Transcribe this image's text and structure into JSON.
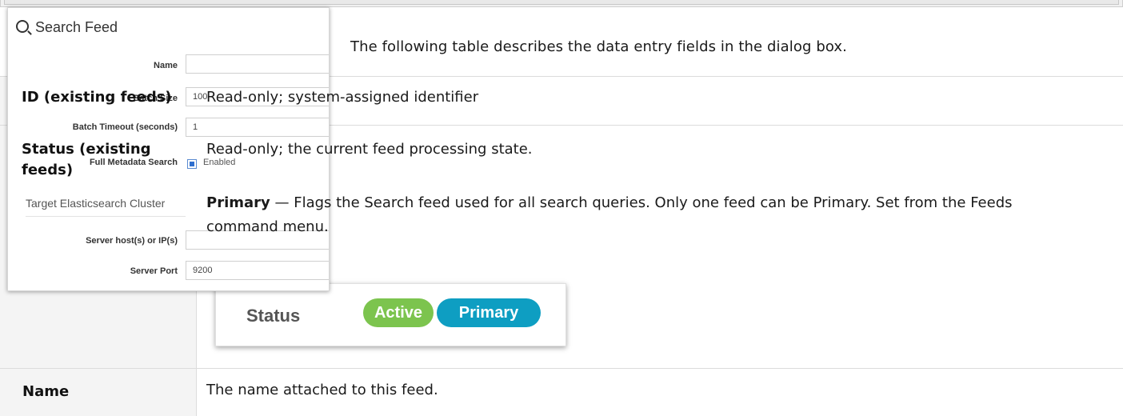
{
  "intro_text": "The following table describes the data entry fields in the dialog box.",
  "table": {
    "rows": [
      {
        "key": "ID (existing feeds)",
        "value": "Read-only; system-assigned identifier"
      },
      {
        "key_line1": "Status (existing",
        "key_line2": "feeds)",
        "value": "Read-only; the current feed processing state.",
        "primary_term": "Primary",
        "primary_desc_line1": " — Flags the Search feed used for all search queries. Only one feed can be Primary. Set from the Feeds",
        "primary_desc_line2": "command menu."
      },
      {
        "key": "Name",
        "value": "The name attached to this feed."
      }
    ]
  },
  "status_image": {
    "label": "Status",
    "badges": [
      {
        "text": "Active",
        "color": "#7cc44e"
      },
      {
        "text": "Primary",
        "color": "#0e9ec2"
      }
    ]
  },
  "dialog": {
    "title": "Search Feed",
    "title_icon": "search-icon",
    "fields": [
      {
        "label": "Name",
        "value": ""
      },
      {
        "label": "Batch Size",
        "value": "100"
      },
      {
        "label": "Batch Timeout (seconds)",
        "value": "1"
      },
      {
        "label": "Full Metadata Search",
        "checkbox_label": "Enabled"
      }
    ],
    "section_title": "Target Elasticsearch Cluster",
    "cluster_fields": [
      {
        "label": "Server host(s) or IP(s)",
        "value": ""
      },
      {
        "label": "Server Port",
        "value": "9200"
      }
    ]
  }
}
